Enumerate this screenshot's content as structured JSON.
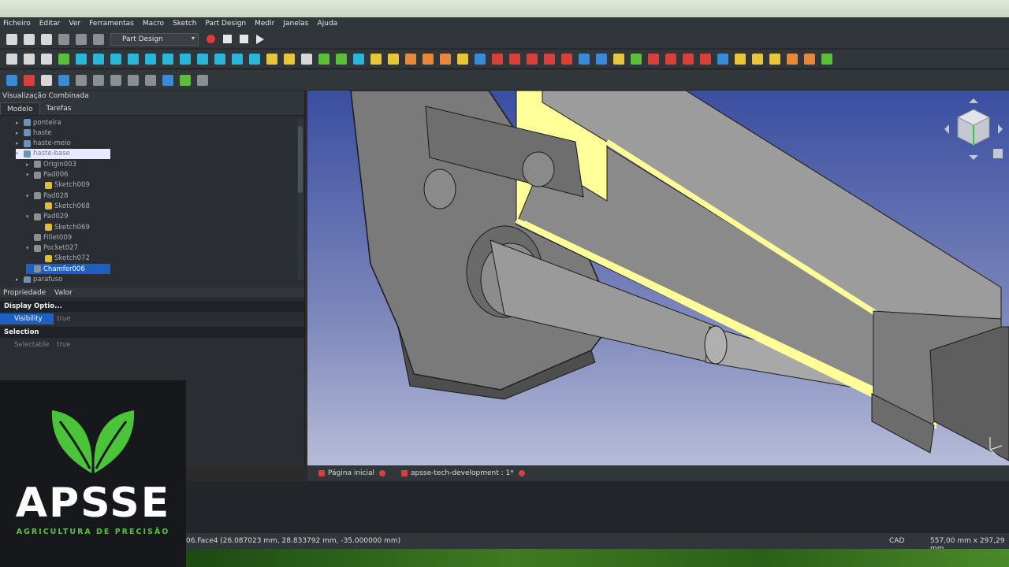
{
  "menu": [
    "Ficheiro",
    "Editar",
    "Ver",
    "Ferramentas",
    "Macro",
    "Sketch",
    "Part Design",
    "Medir",
    "Janelas",
    "Ajuda"
  ],
  "toolbar": {
    "workbench": "Part Design"
  },
  "panel": {
    "title": "Visualização Combinada",
    "tabs": [
      "Modelo",
      "Tarefas"
    ],
    "tree": [
      {
        "label": "ponteira",
        "level": 1,
        "kind": "body",
        "arrow": "▸"
      },
      {
        "label": "haste",
        "level": 1,
        "kind": "body",
        "arrow": "▸"
      },
      {
        "label": "haste-meio",
        "level": 1,
        "kind": "body",
        "arrow": "▸"
      },
      {
        "label": "haste-base",
        "level": 1,
        "kind": "body",
        "arrow": "▾",
        "state": "hl"
      },
      {
        "label": "Origin003",
        "level": 2,
        "kind": "origin",
        "arrow": "▸"
      },
      {
        "label": "Pad006",
        "level": 2,
        "kind": "feature",
        "arrow": "▾"
      },
      {
        "label": "Sketch009",
        "level": 3,
        "kind": "sketch",
        "arrow": ""
      },
      {
        "label": "Pad028",
        "level": 2,
        "kind": "feature",
        "arrow": "▾"
      },
      {
        "label": "Sketch068",
        "level": 3,
        "kind": "sketch",
        "arrow": ""
      },
      {
        "label": "Pad029",
        "level": 2,
        "kind": "feature",
        "arrow": "▾"
      },
      {
        "label": "Sketch069",
        "level": 3,
        "kind": "sketch",
        "arrow": ""
      },
      {
        "label": "Fillet009",
        "level": 2,
        "kind": "feature",
        "arrow": ""
      },
      {
        "label": "Pocket027",
        "level": 2,
        "kind": "feature",
        "arrow": "▾"
      },
      {
        "label": "Sketch072",
        "level": 3,
        "kind": "sketch",
        "arrow": ""
      },
      {
        "label": "Chamfer006",
        "level": 2,
        "kind": "feature",
        "arrow": "",
        "state": "sel"
      },
      {
        "label": "parafuso",
        "level": 1,
        "kind": "body",
        "arrow": "▸"
      }
    ]
  },
  "properties": {
    "headers": [
      "Propriedade",
      "Valor"
    ],
    "groups": [
      {
        "name": "Display Optio...",
        "rows": [
          {
            "key": "Visibility",
            "value": "true",
            "state": "sel"
          }
        ]
      },
      {
        "name": "Selection",
        "rows": [
          {
            "key": "Selectable",
            "value": "true",
            "state": "dim"
          }
        ]
      }
    ]
  },
  "doc_tabs": [
    {
      "label": "Página inicial"
    },
    {
      "label": "apsse-tech-development : 1*"
    }
  ],
  "status": {
    "selection": "06.Face4 (26.087023 mm, 28.833792 mm, -35.000000 mm)",
    "nav": "CAD",
    "dims": "557,00 mm x 297,29 mm"
  },
  "logo": {
    "title": "APSSE",
    "subtitle": "AGRICULTURA DE PRECISÃO",
    "leaf_color": "#4cc43a"
  },
  "colors": {
    "highlight": "#ffff99",
    "selection": "#1f5fc2"
  }
}
